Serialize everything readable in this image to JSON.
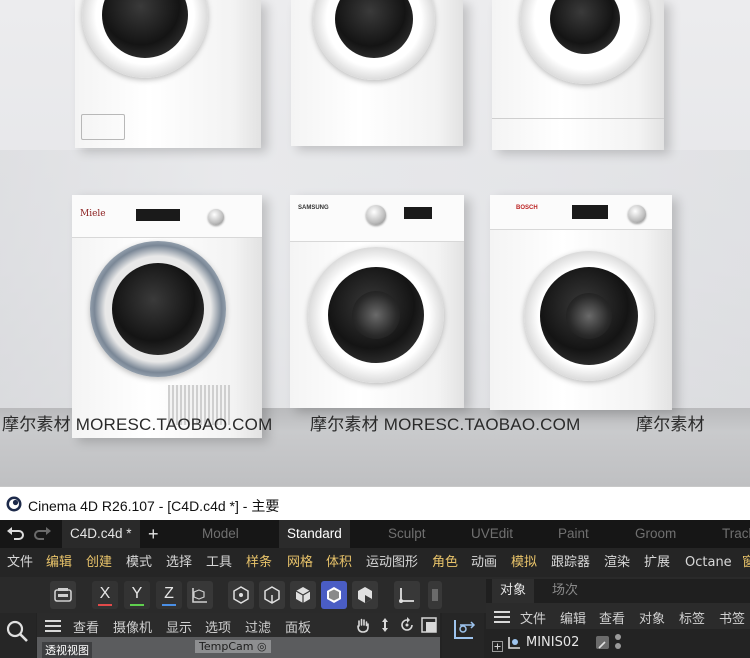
{
  "render": {
    "watermarks": [
      "摩尔素材 MORESC.TAOBAO.COM",
      "摩尔素材 MORESC.TAOBAO.COM",
      "摩尔素材"
    ],
    "brands": [
      "Miele",
      "SAMSUNG",
      "BOSCH"
    ]
  },
  "titlebar": {
    "title": "Cinema 4D R26.107 - [C4D.c4d *] - 主要"
  },
  "tabs": {
    "doc": "C4D.c4d *",
    "add": "+",
    "items": [
      "Model",
      "Standard",
      "Sculpt",
      "UVEdit",
      "Paint",
      "Groom",
      "Track"
    ]
  },
  "menu": {
    "items": [
      "文件",
      "编辑",
      "创建",
      "模式",
      "选择",
      "工具",
      "样条",
      "网格",
      "体积",
      "运动图形",
      "角色",
      "动画",
      "模拟",
      "跟踪器",
      "渲染",
      "扩展",
      "Octane",
      "窗"
    ]
  },
  "toolbar": {
    "axes": [
      "X",
      "Y",
      "Z"
    ]
  },
  "viewport": {
    "menu": [
      "查看",
      "摄像机",
      "显示",
      "选项",
      "过滤",
      "面板"
    ],
    "view_label": "透视视图",
    "camera": "TempCam"
  },
  "objects": {
    "tabs": [
      "对象",
      "场次"
    ],
    "menu": [
      "文件",
      "编辑",
      "查看",
      "对象",
      "标签",
      "书签"
    ],
    "item": "MINIS02"
  },
  "colors": {
    "accent": "#3e8fe0",
    "menu_gold": "#e8c36a",
    "axis_x": "#e24a4a",
    "axis_y": "#5fcf4e",
    "axis_z": "#4a8fe6"
  }
}
